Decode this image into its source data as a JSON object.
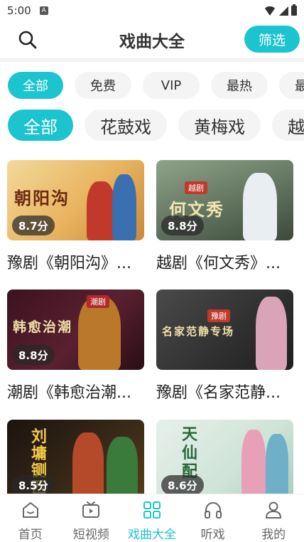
{
  "status_bar": {
    "time": "5:00",
    "notification_glyph": "A"
  },
  "header": {
    "title": "戏曲大全",
    "filter_label": "筛选"
  },
  "filters_row1": [
    "全部",
    "免费",
    "VIP",
    "最热",
    "最新"
  ],
  "filters_row1_selected": "全部",
  "filters_row2": [
    "全部",
    "花鼓戏",
    "黄梅戏",
    "越剧"
  ],
  "filters_row2_selected": "全部",
  "cards": [
    {
      "thumb_text": "朝阳沟",
      "rating": "8.7分",
      "title": "豫剧《朝阳沟》..."
    },
    {
      "thumb_text": "何文秀",
      "badge": "越剧",
      "rating": "8.8分",
      "title": "越剧《何文秀》..."
    },
    {
      "thumb_text": "韩愈治潮",
      "badge": "潮剧",
      "rating": "8.8分",
      "title": "潮剧《韩愈治潮..."
    },
    {
      "thumb_text": "名家范静专场",
      "badge": "豫剧",
      "rating": "",
      "title": "豫剧《名家范静..."
    },
    {
      "thumb_text": "刘墉铡西",
      "rating": "8.5分",
      "title": ""
    },
    {
      "thumb_text": "天仙配",
      "rating": "8.6分",
      "title": ""
    }
  ],
  "nav": [
    {
      "label": "首页",
      "icon": "home-icon"
    },
    {
      "label": "短视频",
      "icon": "tv-icon"
    },
    {
      "label": "戏曲大全",
      "icon": "grid-icon"
    },
    {
      "label": "听戏",
      "icon": "headphones-icon"
    },
    {
      "label": "我的",
      "icon": "person-icon"
    }
  ],
  "nav_active": "戏曲大全",
  "colors": {
    "accent": "#1cc4cf",
    "chip_bg": "#f4f4f4"
  }
}
